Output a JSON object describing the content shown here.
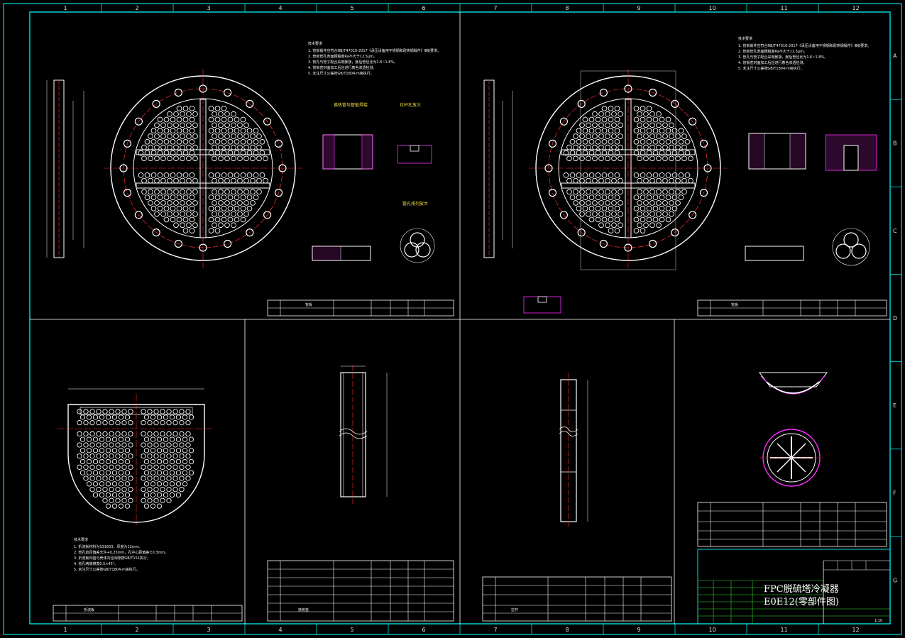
{
  "sheet": {
    "columns": [
      "1",
      "2",
      "3",
      "4",
      "5",
      "6",
      "7",
      "8",
      "9",
      "10",
      "11",
      "12"
    ],
    "rows": [
      "A",
      "B",
      "C",
      "D",
      "E",
      "F",
      "G"
    ]
  },
  "title_block": {
    "project": "FPC脱硫塔冷凝器",
    "drawing_no": "E0E12(零部件图)",
    "scale_label": "1:10"
  },
  "views": {
    "tubesheet_left_label": "管板",
    "tubesheet_right_label": "管板",
    "baffle_label": "折流板",
    "tube_label": "换热管",
    "rod_label": "拉杆"
  },
  "colors": {
    "frame": "#00e0e0",
    "line": "#ffffff",
    "red": "#ff3030",
    "magenta": "#ff30ff",
    "yellow": "#f0e040",
    "green": "#30e030"
  }
}
